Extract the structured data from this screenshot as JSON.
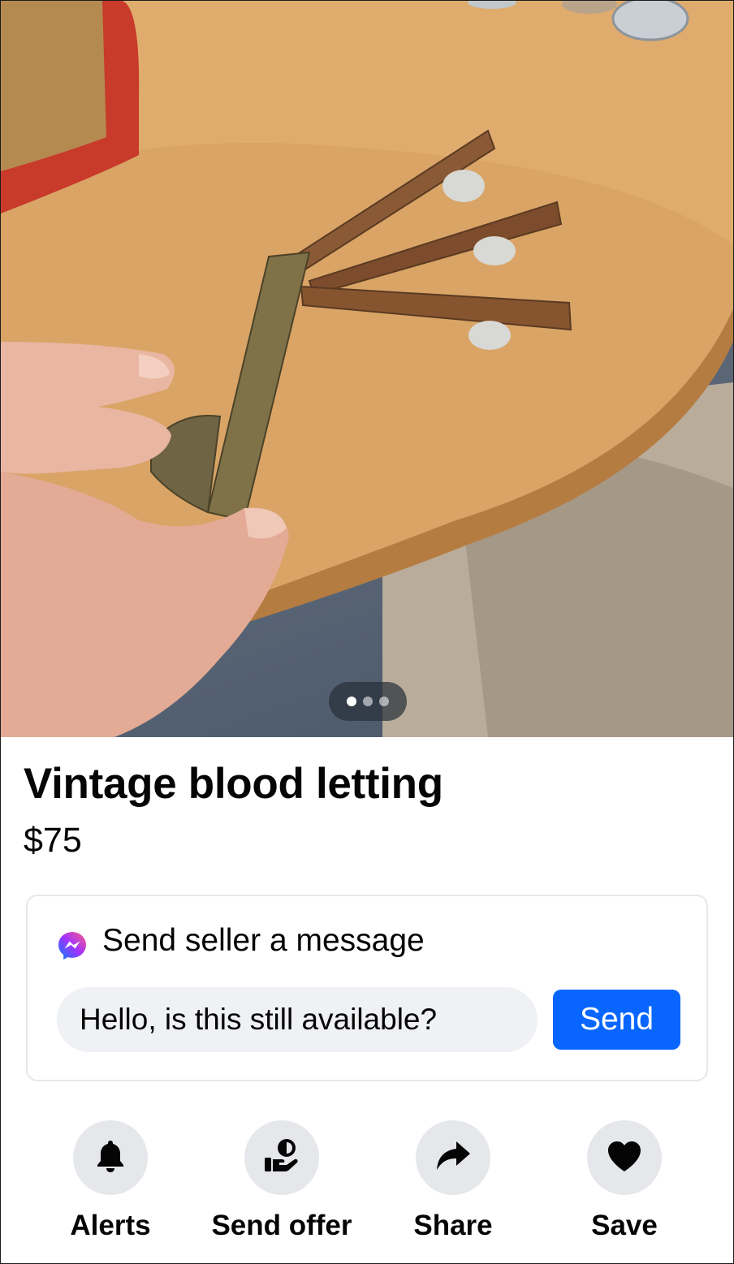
{
  "listing": {
    "title": "Vintage blood letting",
    "price": "$75",
    "photo": {
      "pager_count": 3,
      "active_index": 0
    }
  },
  "message": {
    "heading": "Send seller a message",
    "input_value": "Hello, is this still available?",
    "send_label": "Send",
    "icon": "messenger-icon"
  },
  "actions": [
    {
      "label": "Alerts",
      "icon": "bell-icon"
    },
    {
      "label": "Send offer",
      "icon": "offer-icon"
    },
    {
      "label": "Share",
      "icon": "share-icon"
    },
    {
      "label": "Save",
      "icon": "heart-icon"
    }
  ],
  "colors": {
    "accent": "#0866ff",
    "icon_bg": "#e5e7eb",
    "input_bg": "#eff1f4",
    "text": "#050505"
  }
}
